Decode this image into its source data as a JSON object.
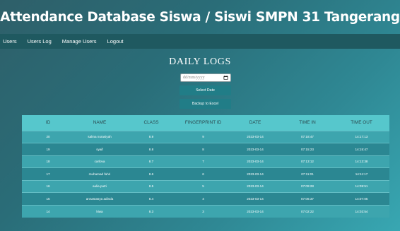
{
  "header": {
    "title": "Attendance Database Siswa / Siswi SMPN 31 Tangerang"
  },
  "nav": {
    "items": [
      {
        "label": "Users"
      },
      {
        "label": "Users Log"
      },
      {
        "label": "Manage Users"
      },
      {
        "label": "Logout"
      }
    ]
  },
  "main": {
    "heading": "DAILY LOGS",
    "date_input": {
      "placeholder": "dd/mm/yyyy",
      "icon": "calendar-icon"
    },
    "select_button": "Select Date",
    "backup_button": "Backup to Excel"
  },
  "table": {
    "columns": [
      "ID",
      "NAME",
      "CLASS",
      "FINGERPRINT ID",
      "DATE",
      "TIME IN",
      "TIME OUT"
    ],
    "rows": [
      [
        "20",
        "salma nurasiyah",
        "8.9",
        "9",
        "2023-03-14",
        "07:18:47",
        "14:17:13"
      ],
      [
        "19",
        "syaif",
        "8.8",
        "8",
        "2023-03-14",
        "07:15:23",
        "14:15:47"
      ],
      [
        "18",
        "carlova",
        "8.7",
        "7",
        "2023-03-14",
        "07:13:12",
        "14:13:38"
      ],
      [
        "17",
        "muhamad fahri",
        "8.6",
        "6",
        "2023-03-14",
        "07:11:01",
        "14:11:17"
      ],
      [
        "16",
        "aulia putri",
        "8.5",
        "5",
        "2023-03-14",
        "07:09:28",
        "14:09:51"
      ],
      [
        "15",
        "annastasya adinda",
        "8.4",
        "4",
        "2023-03-14",
        "07:06:37",
        "14:07:05"
      ],
      [
        "14",
        "kiwa",
        "8.3",
        "3",
        "2023-03-14",
        "07:02:22",
        "14:03:54"
      ]
    ]
  },
  "colors": {
    "nav_bg": "#1f5960",
    "header_row": "#56c7cc",
    "row_light": "#3da5ae",
    "row_dark": "#2b8792",
    "button": "#217d87"
  }
}
